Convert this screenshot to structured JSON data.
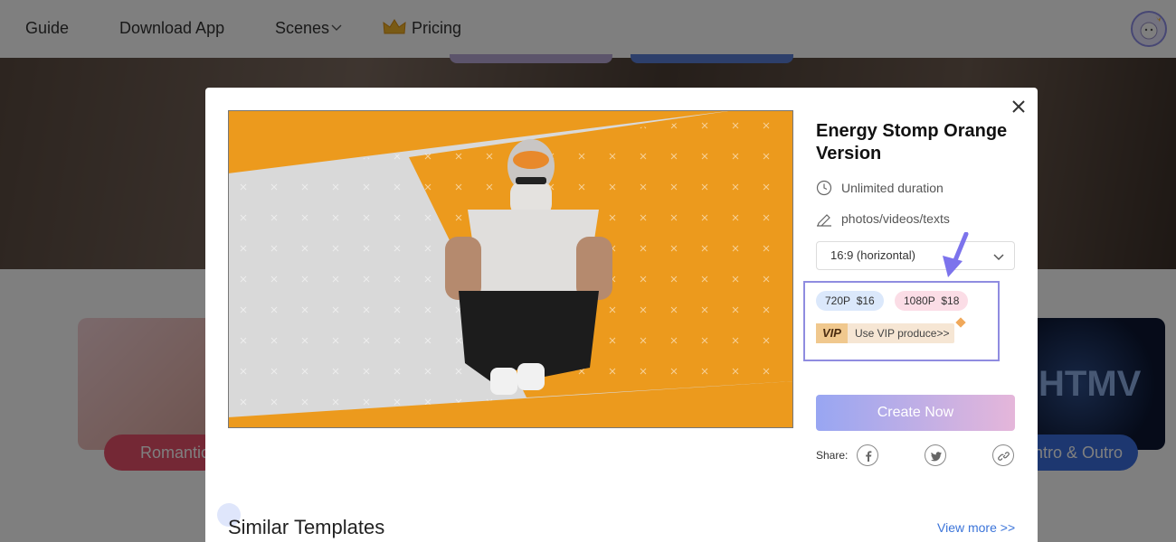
{
  "nav": {
    "guide": "Guide",
    "download": "Download App",
    "scenes": "Scenes",
    "pricing": "Pricing"
  },
  "background_cards": {
    "left_label": "Romantic",
    "right_label": "Intro & Outro",
    "right_image_text": "HTMV"
  },
  "modal": {
    "title": "Energy Stomp Orange Version",
    "duration": "Unlimited duration",
    "media": "photos/videos/texts",
    "ratio_selected": "16:9 (horizontal)",
    "resolutions": [
      {
        "label": "720P",
        "price": "$16"
      },
      {
        "label": "1080P",
        "price": "$18"
      }
    ],
    "vip_tag": "VIP",
    "vip_text": "Use VIP produce>>",
    "create_label": "Create Now",
    "share_label": "Share:",
    "similar_title": "Similar Templates",
    "view_more": "View more >>"
  },
  "icons": [
    "crown-icon",
    "chevron-down-icon",
    "avatar-icon",
    "close-icon",
    "clock-icon",
    "edit-icon",
    "facebook-icon",
    "twitter-icon",
    "link-icon"
  ],
  "colors": {
    "accent": "#3b74d9",
    "create_gradient_start": "#98a6f2",
    "create_gradient_end": "#e5b6da",
    "highlight": "#8f8ce0",
    "vip_gold": "#f0c88e"
  }
}
